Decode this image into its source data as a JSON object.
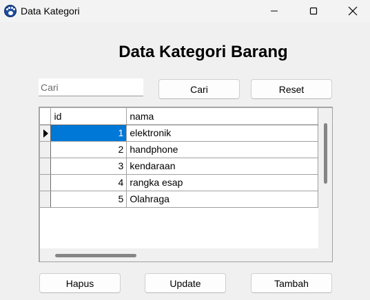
{
  "window": {
    "title": "Data Kategori",
    "icon": "paw-icon"
  },
  "page": {
    "title": "Data Kategori Barang"
  },
  "search": {
    "placeholder": "Cari",
    "value": "",
    "button_label": "Cari",
    "reset_label": "Reset"
  },
  "grid": {
    "columns": [
      "id",
      "nama"
    ],
    "rows": [
      {
        "id": "1",
        "nama": "elektronik"
      },
      {
        "id": "2",
        "nama": "handphone"
      },
      {
        "id": "3",
        "nama": "kendaraan"
      },
      {
        "id": "4",
        "nama": "rangka esap"
      },
      {
        "id": "5",
        "nama": "Olahraga"
      }
    ],
    "selected_row": 0,
    "selection_color": "#0078d7"
  },
  "actions": {
    "hapus_label": "Hapus",
    "update_label": "Update",
    "tambah_label": "Tambah"
  }
}
